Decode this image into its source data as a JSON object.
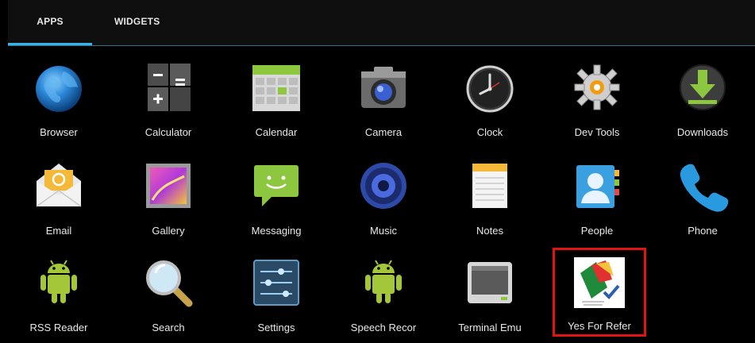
{
  "tabs": [
    {
      "label": "APPS",
      "selected": true
    },
    {
      "label": "WIDGETS",
      "selected": false
    }
  ],
  "accent_color": "#33b5e5",
  "highlight_color": "#e01414",
  "apps": [
    {
      "label": "Browser",
      "icon": "globe-icon"
    },
    {
      "label": "Calculator",
      "icon": "calculator-icon"
    },
    {
      "label": "Calendar",
      "icon": "calendar-icon"
    },
    {
      "label": "Camera",
      "icon": "camera-icon"
    },
    {
      "label": "Clock",
      "icon": "clock-icon"
    },
    {
      "label": "Dev Tools",
      "icon": "gear-icon"
    },
    {
      "label": "Downloads",
      "icon": "download-icon"
    },
    {
      "label": "Email",
      "icon": "envelope-icon"
    },
    {
      "label": "Gallery",
      "icon": "gallery-icon"
    },
    {
      "label": "Messaging",
      "icon": "chat-bubble-icon"
    },
    {
      "label": "Music",
      "icon": "speaker-icon"
    },
    {
      "label": "Notes",
      "icon": "notepad-icon"
    },
    {
      "label": "People",
      "icon": "contacts-icon"
    },
    {
      "label": "Phone",
      "icon": "phone-handset-icon"
    },
    {
      "label": "RSS Reader",
      "icon": "android-robot-icon"
    },
    {
      "label": "Search",
      "icon": "magnifier-icon"
    },
    {
      "label": "Settings",
      "icon": "sliders-icon"
    },
    {
      "label": "Speech Recor",
      "icon": "android-robot-icon"
    },
    {
      "label": "Terminal Emu",
      "icon": "terminal-icon"
    },
    {
      "label": "Yes For Refer",
      "icon": "yes-for-refer-logo-icon",
      "highlighted": true
    }
  ]
}
